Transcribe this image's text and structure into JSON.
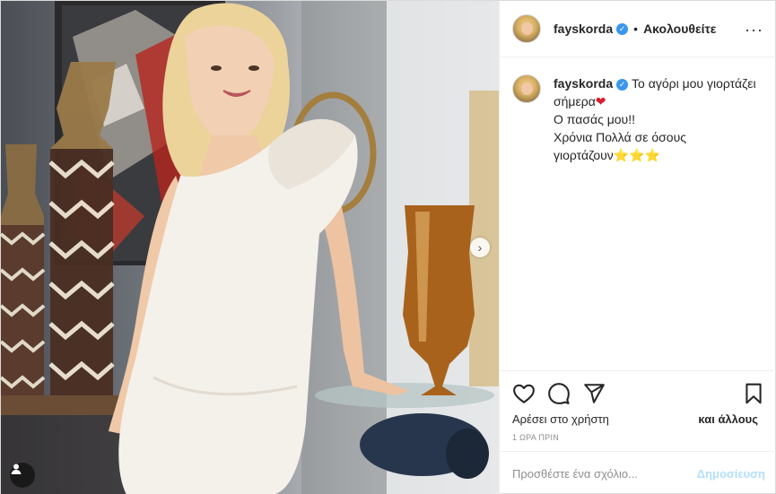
{
  "post": {
    "username": "fayskorda",
    "follow_label": "Ακολουθείτε",
    "separator": "•",
    "more_label": "···",
    "caption": {
      "username": "fayskorda",
      "line1": "Το αγόρι μου γιορτάζει σήμερα",
      "heart": "❤",
      "line2": "Ο πασάς μου!!",
      "line3": "Χρόνια Πολλά σε όσους γιορτάζουν",
      "stars": "⭐⭐⭐"
    },
    "likes_text": "Αρέσει στο χρήστη",
    "likes_others": "και άλλους",
    "timestamp": "1 ΩΡΑ ΠΡΙΝ",
    "comment_placeholder": "Προσθέστε ένα σχόλιο...",
    "post_button_label": "Δημοσίευση",
    "carousel_next": "›"
  },
  "colors": {
    "verified": "#3897f0",
    "post_button_disabled": "#b2dffc",
    "muted_text": "#8e8e8e",
    "border": "#dbdbdb"
  },
  "icons": {
    "like": "heart-icon",
    "comment": "comment-icon",
    "share": "share-icon",
    "save": "bookmark-icon",
    "tag": "user-tag-icon",
    "more": "more-options-icon"
  }
}
